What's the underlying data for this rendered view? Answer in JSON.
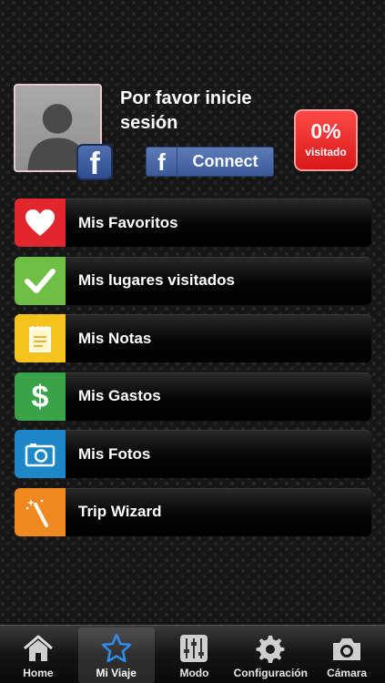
{
  "profile": {
    "login_prompt": "Por favor inicie sesión",
    "connect_label": "Connect",
    "facebook_letter": "f",
    "visited_percent": "0%",
    "visited_label": "visitado"
  },
  "menu": {
    "items": [
      {
        "label": "Mis Favoritos",
        "icon": "heart-icon",
        "color": "#e2262f"
      },
      {
        "label": "Mis lugares visitados",
        "icon": "checkmark-icon",
        "color": "#6fbe45"
      },
      {
        "label": "Mis Notas",
        "icon": "notepad-icon",
        "color": "#f6c21c"
      },
      {
        "label": "Mis Gastos",
        "icon": "dollar-icon",
        "color": "#3aa34a"
      },
      {
        "label": "Mis Fotos",
        "icon": "camera-icon",
        "color": "#1d87c8"
      },
      {
        "label": "Trip Wizard",
        "icon": "magic-wand-icon",
        "color": "#f0891f"
      }
    ]
  },
  "tabbar": {
    "tabs": [
      {
        "label": "Home",
        "icon": "home-icon"
      },
      {
        "label": "Mi Viaje",
        "icon": "star-icon",
        "active": true
      },
      {
        "label": "Modo",
        "icon": "sliders-icon"
      },
      {
        "label": "Configuración",
        "icon": "gear-icon"
      },
      {
        "label": "Cámara",
        "icon": "camera-icon"
      }
    ]
  }
}
